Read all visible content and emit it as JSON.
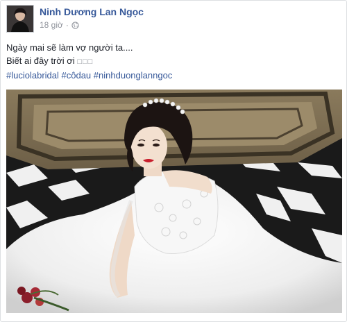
{
  "post": {
    "author_name": "Ninh Dương Lan Ngọc",
    "timestamp": "18 giờ",
    "separator": "·",
    "privacy_icon": "globe-icon",
    "text_line1": "Ngày mai sẽ làm vợ người ta....",
    "text_line2": "Biết ai đây trời ơi",
    "text_line2_glyphs": "□□□",
    "hashtags": [
      "#luciolabridal",
      "#côdau",
      "#ninhduonglanngoc"
    ],
    "photo_subject": "bride-photo"
  },
  "colors": {
    "link": "#365899",
    "text": "#1d2129",
    "meta": "#90949c",
    "border": "#dddfe2"
  }
}
